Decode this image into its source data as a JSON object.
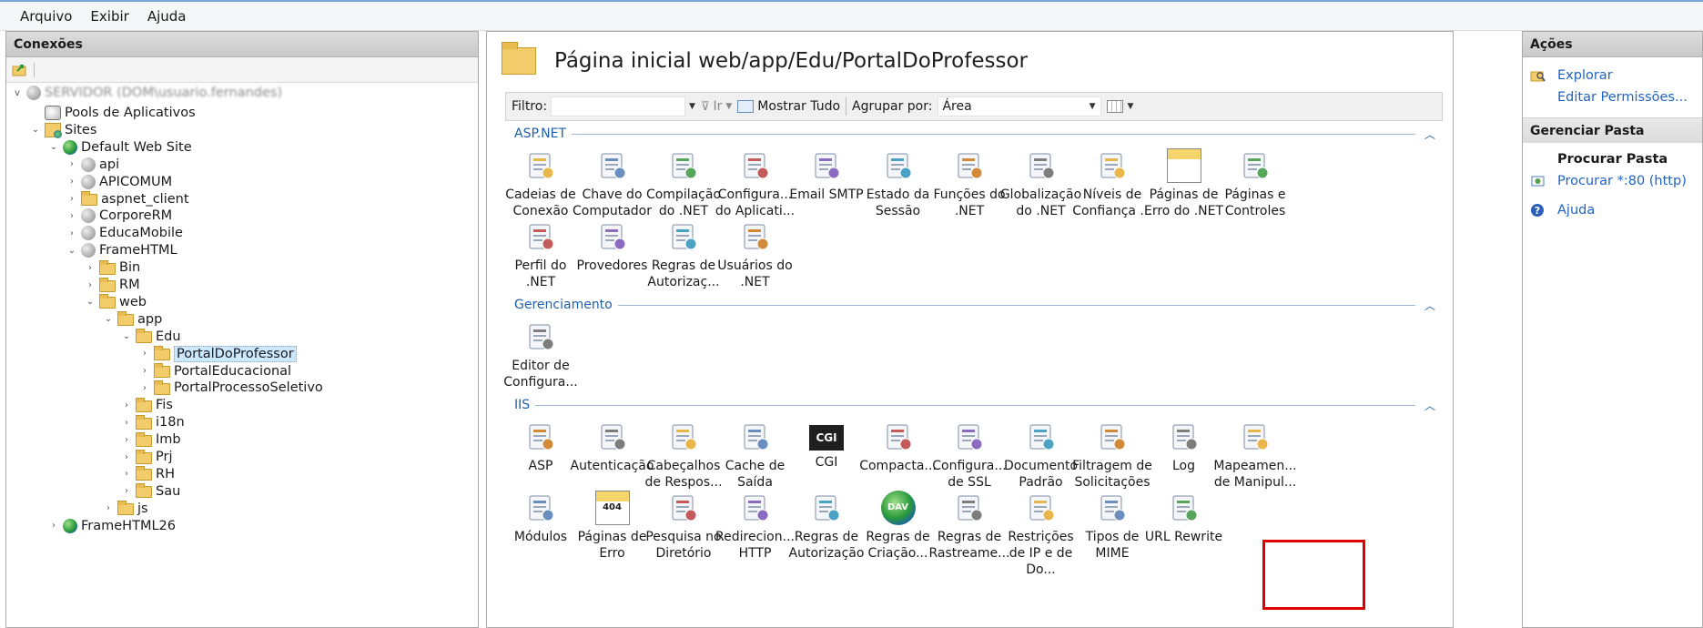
{
  "menu": [
    "Arquivo",
    "Exibir",
    "Ajuda"
  ],
  "connections": {
    "title": "Conexões",
    "server_label": "SERVIDOR (DOM\\usuario.fernandes)",
    "tree": [
      {
        "label": "Pools de Aplicativos",
        "icon": "pool",
        "level": 1,
        "twisty": ""
      },
      {
        "label": "Sites",
        "icon": "sites",
        "level": 1,
        "twisty": "v"
      },
      {
        "label": "Default Web Site",
        "icon": "globe",
        "level": 2,
        "twisty": "v"
      },
      {
        "label": "api",
        "icon": "app",
        "level": 3,
        "twisty": ">"
      },
      {
        "label": "APICOMUM",
        "icon": "app",
        "level": 3,
        "twisty": ">"
      },
      {
        "label": "aspnet_client",
        "icon": "folder",
        "level": 3,
        "twisty": ">"
      },
      {
        "label": "CorporeRM",
        "icon": "app",
        "level": 3,
        "twisty": ">"
      },
      {
        "label": "EducaMobile",
        "icon": "app",
        "level": 3,
        "twisty": ">"
      },
      {
        "label": "FrameHTML",
        "icon": "app",
        "level": 3,
        "twisty": "v"
      },
      {
        "label": "Bin",
        "icon": "folder",
        "level": 4,
        "twisty": ">"
      },
      {
        "label": "RM",
        "icon": "folder",
        "level": 4,
        "twisty": ">"
      },
      {
        "label": "web",
        "icon": "folder",
        "level": 4,
        "twisty": "v"
      },
      {
        "label": "app",
        "icon": "folder",
        "level": 5,
        "twisty": "v"
      },
      {
        "label": "Edu",
        "icon": "folder",
        "level": 6,
        "twisty": "v"
      },
      {
        "label": "PortalDoProfessor",
        "icon": "folder",
        "level": 7,
        "twisty": ">",
        "selected": true
      },
      {
        "label": "PortalEducacional",
        "icon": "folder",
        "level": 7,
        "twisty": ">"
      },
      {
        "label": "PortalProcessoSeletivo",
        "icon": "folder",
        "level": 7,
        "twisty": ">"
      },
      {
        "label": "Fis",
        "icon": "folder",
        "level": 6,
        "twisty": ">"
      },
      {
        "label": "i18n",
        "icon": "folder",
        "level": 6,
        "twisty": ">"
      },
      {
        "label": "Imb",
        "icon": "folder",
        "level": 6,
        "twisty": ">"
      },
      {
        "label": "Prj",
        "icon": "folder",
        "level": 6,
        "twisty": ">"
      },
      {
        "label": "RH",
        "icon": "folder",
        "level": 6,
        "twisty": ">"
      },
      {
        "label": "Sau",
        "icon": "folder",
        "level": 6,
        "twisty": ">"
      },
      {
        "label": "js",
        "icon": "folder",
        "level": 5,
        "twisty": ">"
      },
      {
        "label": "FrameHTML26",
        "icon": "globe",
        "level": 2,
        "twisty": ">"
      }
    ]
  },
  "page": {
    "title": "Página inicial web/app/Edu/PortalDoProfessor",
    "filter_label": "Filtro:",
    "go_label": "Ir",
    "show_all_label": "Mostrar Tudo",
    "group_by_label": "Agrupar por:",
    "group_by_value": "Área"
  },
  "sections": [
    {
      "name": "ASP.NET",
      "items": [
        {
          "label": "Cadeias de Conexão",
          "icon": "connection-strings-icon"
        },
        {
          "label": "Chave do Computador",
          "icon": "machine-key-icon"
        },
        {
          "label": "Compilação do .NET",
          "icon": "compilation-icon"
        },
        {
          "label": "Configura... do Aplicati...",
          "icon": "app-settings-icon"
        },
        {
          "label": "Email SMTP",
          "icon": "smtp-email-icon"
        },
        {
          "label": "Estado da Sessão",
          "icon": "session-state-icon"
        },
        {
          "label": "Funções do .NET",
          "icon": "net-roles-icon"
        },
        {
          "label": "Globalização do .NET",
          "icon": "globalization-icon"
        },
        {
          "label": "Níveis de Confiança ...",
          "icon": "trust-levels-icon"
        },
        {
          "label": "Páginas de Erro do .NET",
          "icon": "net-error-pages-icon"
        },
        {
          "label": "Páginas e Controles",
          "icon": "pages-controls-icon"
        },
        {
          "label": "Perfil do .NET",
          "icon": "net-profile-icon"
        },
        {
          "label": "Provedores",
          "icon": "providers-icon"
        },
        {
          "label": "Regras de Autorizaç...",
          "icon": "net-authorization-icon"
        },
        {
          "label": "Usuários do .NET",
          "icon": "net-users-icon"
        }
      ]
    },
    {
      "name": "Gerenciamento",
      "items": [
        {
          "label": "Editor de Configura...",
          "icon": "config-editor-icon"
        }
      ]
    },
    {
      "name": "IIS",
      "items": [
        {
          "label": "ASP",
          "icon": "asp-icon"
        },
        {
          "label": "Autenticação",
          "icon": "authentication-icon"
        },
        {
          "label": "Cabeçalhos de Respos...",
          "icon": "response-headers-icon"
        },
        {
          "label": "Cache de Saída",
          "icon": "output-cache-icon"
        },
        {
          "label": "CGI",
          "icon": "cgi-icon",
          "text": "CGI"
        },
        {
          "label": "Compacta...",
          "icon": "compression-icon"
        },
        {
          "label": "Configura... de SSL",
          "icon": "ssl-settings-icon"
        },
        {
          "label": "Documento Padrão",
          "icon": "default-document-icon"
        },
        {
          "label": "Filtragem de Solicitações",
          "icon": "request-filtering-icon"
        },
        {
          "label": "Log",
          "icon": "logging-icon"
        },
        {
          "label": "Mapeamen... de Manipul...",
          "icon": "handler-mappings-icon"
        },
        {
          "label": "Módulos",
          "icon": "modules-icon"
        },
        {
          "label": "Páginas de Erro",
          "icon": "error-pages-icon",
          "text": "404"
        },
        {
          "label": "Pesquisa no Diretório",
          "icon": "directory-browsing-icon"
        },
        {
          "label": "Redirecion... HTTP",
          "icon": "http-redirect-icon"
        },
        {
          "label": "Regras de Autorização",
          "icon": "authorization-rules-icon"
        },
        {
          "label": "Regras de Criação...",
          "icon": "webdav-authoring-icon",
          "text": "DAV"
        },
        {
          "label": "Regras de Rastreame...",
          "icon": "failed-request-tracing-icon"
        },
        {
          "label": "Restrições de IP e de Do...",
          "icon": "ip-restrictions-icon"
        },
        {
          "label": "Tipos de MIME",
          "icon": "mime-types-icon"
        },
        {
          "label": "URL Rewrite",
          "icon": "url-rewrite-icon"
        }
      ]
    }
  ],
  "actions": {
    "title": "Ações",
    "explore": "Explorar",
    "edit_permissions": "Editar Permissões...",
    "manage_folder": "Gerenciar Pasta",
    "browse_folder": "Procurar Pasta",
    "browse_80": "Procurar *:80 (http)",
    "help": "Ajuda"
  },
  "colors": {
    "link": "#1f64c2",
    "section": "#1f5ea8",
    "selection": "#cce8ff",
    "highlight": "#e00000"
  }
}
